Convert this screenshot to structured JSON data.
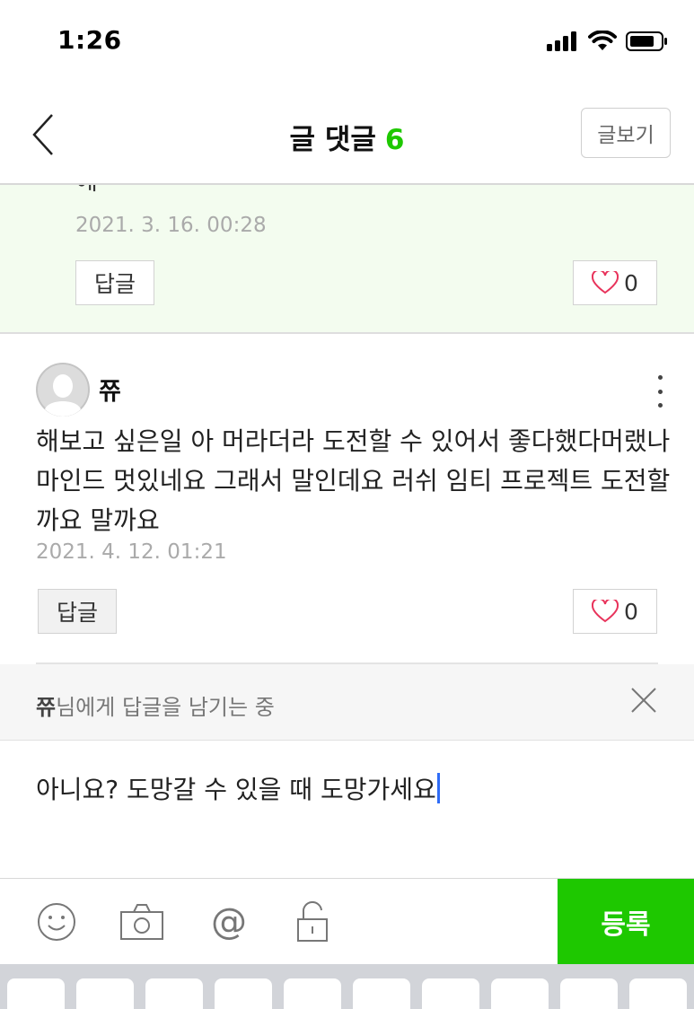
{
  "status_bar": {
    "time": "1:26"
  },
  "nav": {
    "title": "글 댓글",
    "count": "6",
    "view_post_label": "글보기"
  },
  "comments": [
    {
      "text_fragment": "에~~",
      "date": "2021. 3. 16. 00:28",
      "reply_label": "답글",
      "likes": "0"
    },
    {
      "author": "쮸",
      "text": "해보고 싶은일 아 머라더라 도전할 수 있어서 좋다했다머랬나 마인드 멋있네요 그래서 말인데요 러쉬 임티 프로젝트 도전할까요 말까요",
      "date": "2021. 4. 12. 01:21",
      "reply_label": "답글",
      "likes": "0"
    }
  ],
  "replying": {
    "target": "쮸",
    "suffix": "님에게 답글을 남기는 중"
  },
  "input": {
    "value": "아니요? 도망갈 수 있을 때 도망가세요"
  },
  "toolbar": {
    "icons": [
      "emoji-icon",
      "camera-icon",
      "mention-icon",
      "lock-icon"
    ],
    "submit_label": "등록"
  },
  "colors": {
    "accent": "#1ec800",
    "highlight_bg": "#f3fcef",
    "like_heart": "#e8335b",
    "caret": "#2f6cf6"
  }
}
